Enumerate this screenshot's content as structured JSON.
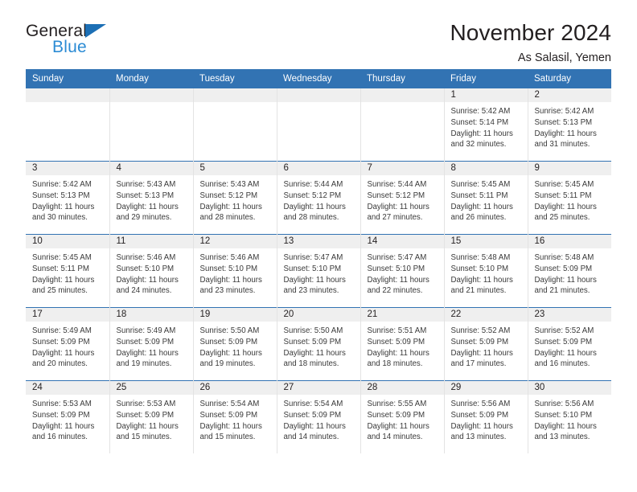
{
  "brand": {
    "name_top": "General",
    "name_bottom": "Blue",
    "accent_color": "#2b8bd4",
    "triangle_color": "#1c6fb5"
  },
  "header": {
    "title": "November 2024",
    "location": "As Salasil, Yemen"
  },
  "theme": {
    "header_blue": "#3273b3",
    "daynum_band": "#efefef",
    "text": "#231f20"
  },
  "weekdays": [
    "Sunday",
    "Monday",
    "Tuesday",
    "Wednesday",
    "Thursday",
    "Friday",
    "Saturday"
  ],
  "labels": {
    "sunrise_prefix": "Sunrise:",
    "sunset_prefix": "Sunset:",
    "daylight_prefix": "Daylight:"
  },
  "weeks": [
    [
      {
        "empty": true
      },
      {
        "empty": true
      },
      {
        "empty": true
      },
      {
        "empty": true
      },
      {
        "empty": true
      },
      {
        "day": "1",
        "sunrise": "Sunrise: 5:42 AM",
        "sunset": "Sunset: 5:14 PM",
        "daylight1": "Daylight: 11 hours",
        "daylight2": "and 32 minutes."
      },
      {
        "day": "2",
        "sunrise": "Sunrise: 5:42 AM",
        "sunset": "Sunset: 5:13 PM",
        "daylight1": "Daylight: 11 hours",
        "daylight2": "and 31 minutes."
      }
    ],
    [
      {
        "day": "3",
        "sunrise": "Sunrise: 5:42 AM",
        "sunset": "Sunset: 5:13 PM",
        "daylight1": "Daylight: 11 hours",
        "daylight2": "and 30 minutes."
      },
      {
        "day": "4",
        "sunrise": "Sunrise: 5:43 AM",
        "sunset": "Sunset: 5:13 PM",
        "daylight1": "Daylight: 11 hours",
        "daylight2": "and 29 minutes."
      },
      {
        "day": "5",
        "sunrise": "Sunrise: 5:43 AM",
        "sunset": "Sunset: 5:12 PM",
        "daylight1": "Daylight: 11 hours",
        "daylight2": "and 28 minutes."
      },
      {
        "day": "6",
        "sunrise": "Sunrise: 5:44 AM",
        "sunset": "Sunset: 5:12 PM",
        "daylight1": "Daylight: 11 hours",
        "daylight2": "and 28 minutes."
      },
      {
        "day": "7",
        "sunrise": "Sunrise: 5:44 AM",
        "sunset": "Sunset: 5:12 PM",
        "daylight1": "Daylight: 11 hours",
        "daylight2": "and 27 minutes."
      },
      {
        "day": "8",
        "sunrise": "Sunrise: 5:45 AM",
        "sunset": "Sunset: 5:11 PM",
        "daylight1": "Daylight: 11 hours",
        "daylight2": "and 26 minutes."
      },
      {
        "day": "9",
        "sunrise": "Sunrise: 5:45 AM",
        "sunset": "Sunset: 5:11 PM",
        "daylight1": "Daylight: 11 hours",
        "daylight2": "and 25 minutes."
      }
    ],
    [
      {
        "day": "10",
        "sunrise": "Sunrise: 5:45 AM",
        "sunset": "Sunset: 5:11 PM",
        "daylight1": "Daylight: 11 hours",
        "daylight2": "and 25 minutes."
      },
      {
        "day": "11",
        "sunrise": "Sunrise: 5:46 AM",
        "sunset": "Sunset: 5:10 PM",
        "daylight1": "Daylight: 11 hours",
        "daylight2": "and 24 minutes."
      },
      {
        "day": "12",
        "sunrise": "Sunrise: 5:46 AM",
        "sunset": "Sunset: 5:10 PM",
        "daylight1": "Daylight: 11 hours",
        "daylight2": "and 23 minutes."
      },
      {
        "day": "13",
        "sunrise": "Sunrise: 5:47 AM",
        "sunset": "Sunset: 5:10 PM",
        "daylight1": "Daylight: 11 hours",
        "daylight2": "and 23 minutes."
      },
      {
        "day": "14",
        "sunrise": "Sunrise: 5:47 AM",
        "sunset": "Sunset: 5:10 PM",
        "daylight1": "Daylight: 11 hours",
        "daylight2": "and 22 minutes."
      },
      {
        "day": "15",
        "sunrise": "Sunrise: 5:48 AM",
        "sunset": "Sunset: 5:10 PM",
        "daylight1": "Daylight: 11 hours",
        "daylight2": "and 21 minutes."
      },
      {
        "day": "16",
        "sunrise": "Sunrise: 5:48 AM",
        "sunset": "Sunset: 5:09 PM",
        "daylight1": "Daylight: 11 hours",
        "daylight2": "and 21 minutes."
      }
    ],
    [
      {
        "day": "17",
        "sunrise": "Sunrise: 5:49 AM",
        "sunset": "Sunset: 5:09 PM",
        "daylight1": "Daylight: 11 hours",
        "daylight2": "and 20 minutes."
      },
      {
        "day": "18",
        "sunrise": "Sunrise: 5:49 AM",
        "sunset": "Sunset: 5:09 PM",
        "daylight1": "Daylight: 11 hours",
        "daylight2": "and 19 minutes."
      },
      {
        "day": "19",
        "sunrise": "Sunrise: 5:50 AM",
        "sunset": "Sunset: 5:09 PM",
        "daylight1": "Daylight: 11 hours",
        "daylight2": "and 19 minutes."
      },
      {
        "day": "20",
        "sunrise": "Sunrise: 5:50 AM",
        "sunset": "Sunset: 5:09 PM",
        "daylight1": "Daylight: 11 hours",
        "daylight2": "and 18 minutes."
      },
      {
        "day": "21",
        "sunrise": "Sunrise: 5:51 AM",
        "sunset": "Sunset: 5:09 PM",
        "daylight1": "Daylight: 11 hours",
        "daylight2": "and 18 minutes."
      },
      {
        "day": "22",
        "sunrise": "Sunrise: 5:52 AM",
        "sunset": "Sunset: 5:09 PM",
        "daylight1": "Daylight: 11 hours",
        "daylight2": "and 17 minutes."
      },
      {
        "day": "23",
        "sunrise": "Sunrise: 5:52 AM",
        "sunset": "Sunset: 5:09 PM",
        "daylight1": "Daylight: 11 hours",
        "daylight2": "and 16 minutes."
      }
    ],
    [
      {
        "day": "24",
        "sunrise": "Sunrise: 5:53 AM",
        "sunset": "Sunset: 5:09 PM",
        "daylight1": "Daylight: 11 hours",
        "daylight2": "and 16 minutes."
      },
      {
        "day": "25",
        "sunrise": "Sunrise: 5:53 AM",
        "sunset": "Sunset: 5:09 PM",
        "daylight1": "Daylight: 11 hours",
        "daylight2": "and 15 minutes."
      },
      {
        "day": "26",
        "sunrise": "Sunrise: 5:54 AM",
        "sunset": "Sunset: 5:09 PM",
        "daylight1": "Daylight: 11 hours",
        "daylight2": "and 15 minutes."
      },
      {
        "day": "27",
        "sunrise": "Sunrise: 5:54 AM",
        "sunset": "Sunset: 5:09 PM",
        "daylight1": "Daylight: 11 hours",
        "daylight2": "and 14 minutes."
      },
      {
        "day": "28",
        "sunrise": "Sunrise: 5:55 AM",
        "sunset": "Sunset: 5:09 PM",
        "daylight1": "Daylight: 11 hours",
        "daylight2": "and 14 minutes."
      },
      {
        "day": "29",
        "sunrise": "Sunrise: 5:56 AM",
        "sunset": "Sunset: 5:09 PM",
        "daylight1": "Daylight: 11 hours",
        "daylight2": "and 13 minutes."
      },
      {
        "day": "30",
        "sunrise": "Sunrise: 5:56 AM",
        "sunset": "Sunset: 5:10 PM",
        "daylight1": "Daylight: 11 hours",
        "daylight2": "and 13 minutes."
      }
    ]
  ]
}
